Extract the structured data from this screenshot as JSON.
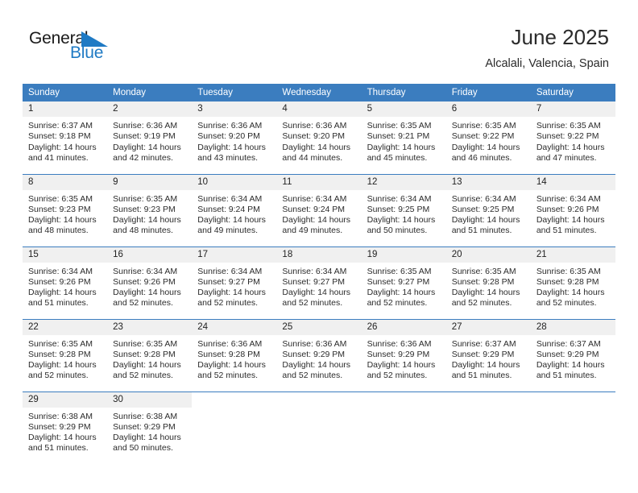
{
  "brand": {
    "word_general": "General",
    "word_blue": "Blue",
    "flag_icon": "triangle-flag-icon"
  },
  "header": {
    "title": "June 2025",
    "location": "Alcalali, Valencia, Spain"
  },
  "colors": {
    "header_blue": "#3b7dbf",
    "brand_blue": "#1f7ac4",
    "daynum_bg": "#f0f0f0",
    "text": "#2b2b2b"
  },
  "calendar": {
    "weekday_headers": [
      "Sunday",
      "Monday",
      "Tuesday",
      "Wednesday",
      "Thursday",
      "Friday",
      "Saturday"
    ],
    "weeks": [
      [
        {
          "day": "1",
          "sunrise": "Sunrise: 6:37 AM",
          "sunset": "Sunset: 9:18 PM",
          "daylight": "Daylight: 14 hours and 41 minutes."
        },
        {
          "day": "2",
          "sunrise": "Sunrise: 6:36 AM",
          "sunset": "Sunset: 9:19 PM",
          "daylight": "Daylight: 14 hours and 42 minutes."
        },
        {
          "day": "3",
          "sunrise": "Sunrise: 6:36 AM",
          "sunset": "Sunset: 9:20 PM",
          "daylight": "Daylight: 14 hours and 43 minutes."
        },
        {
          "day": "4",
          "sunrise": "Sunrise: 6:36 AM",
          "sunset": "Sunset: 9:20 PM",
          "daylight": "Daylight: 14 hours and 44 minutes."
        },
        {
          "day": "5",
          "sunrise": "Sunrise: 6:35 AM",
          "sunset": "Sunset: 9:21 PM",
          "daylight": "Daylight: 14 hours and 45 minutes."
        },
        {
          "day": "6",
          "sunrise": "Sunrise: 6:35 AM",
          "sunset": "Sunset: 9:22 PM",
          "daylight": "Daylight: 14 hours and 46 minutes."
        },
        {
          "day": "7",
          "sunrise": "Sunrise: 6:35 AM",
          "sunset": "Sunset: 9:22 PM",
          "daylight": "Daylight: 14 hours and 47 minutes."
        }
      ],
      [
        {
          "day": "8",
          "sunrise": "Sunrise: 6:35 AM",
          "sunset": "Sunset: 9:23 PM",
          "daylight": "Daylight: 14 hours and 48 minutes."
        },
        {
          "day": "9",
          "sunrise": "Sunrise: 6:35 AM",
          "sunset": "Sunset: 9:23 PM",
          "daylight": "Daylight: 14 hours and 48 minutes."
        },
        {
          "day": "10",
          "sunrise": "Sunrise: 6:34 AM",
          "sunset": "Sunset: 9:24 PM",
          "daylight": "Daylight: 14 hours and 49 minutes."
        },
        {
          "day": "11",
          "sunrise": "Sunrise: 6:34 AM",
          "sunset": "Sunset: 9:24 PM",
          "daylight": "Daylight: 14 hours and 49 minutes."
        },
        {
          "day": "12",
          "sunrise": "Sunrise: 6:34 AM",
          "sunset": "Sunset: 9:25 PM",
          "daylight": "Daylight: 14 hours and 50 minutes."
        },
        {
          "day": "13",
          "sunrise": "Sunrise: 6:34 AM",
          "sunset": "Sunset: 9:25 PM",
          "daylight": "Daylight: 14 hours and 51 minutes."
        },
        {
          "day": "14",
          "sunrise": "Sunrise: 6:34 AM",
          "sunset": "Sunset: 9:26 PM",
          "daylight": "Daylight: 14 hours and 51 minutes."
        }
      ],
      [
        {
          "day": "15",
          "sunrise": "Sunrise: 6:34 AM",
          "sunset": "Sunset: 9:26 PM",
          "daylight": "Daylight: 14 hours and 51 minutes."
        },
        {
          "day": "16",
          "sunrise": "Sunrise: 6:34 AM",
          "sunset": "Sunset: 9:26 PM",
          "daylight": "Daylight: 14 hours and 52 minutes."
        },
        {
          "day": "17",
          "sunrise": "Sunrise: 6:34 AM",
          "sunset": "Sunset: 9:27 PM",
          "daylight": "Daylight: 14 hours and 52 minutes."
        },
        {
          "day": "18",
          "sunrise": "Sunrise: 6:34 AM",
          "sunset": "Sunset: 9:27 PM",
          "daylight": "Daylight: 14 hours and 52 minutes."
        },
        {
          "day": "19",
          "sunrise": "Sunrise: 6:35 AM",
          "sunset": "Sunset: 9:27 PM",
          "daylight": "Daylight: 14 hours and 52 minutes."
        },
        {
          "day": "20",
          "sunrise": "Sunrise: 6:35 AM",
          "sunset": "Sunset: 9:28 PM",
          "daylight": "Daylight: 14 hours and 52 minutes."
        },
        {
          "day": "21",
          "sunrise": "Sunrise: 6:35 AM",
          "sunset": "Sunset: 9:28 PM",
          "daylight": "Daylight: 14 hours and 52 minutes."
        }
      ],
      [
        {
          "day": "22",
          "sunrise": "Sunrise: 6:35 AM",
          "sunset": "Sunset: 9:28 PM",
          "daylight": "Daylight: 14 hours and 52 minutes."
        },
        {
          "day": "23",
          "sunrise": "Sunrise: 6:35 AM",
          "sunset": "Sunset: 9:28 PM",
          "daylight": "Daylight: 14 hours and 52 minutes."
        },
        {
          "day": "24",
          "sunrise": "Sunrise: 6:36 AM",
          "sunset": "Sunset: 9:28 PM",
          "daylight": "Daylight: 14 hours and 52 minutes."
        },
        {
          "day": "25",
          "sunrise": "Sunrise: 6:36 AM",
          "sunset": "Sunset: 9:29 PM",
          "daylight": "Daylight: 14 hours and 52 minutes."
        },
        {
          "day": "26",
          "sunrise": "Sunrise: 6:36 AM",
          "sunset": "Sunset: 9:29 PM",
          "daylight": "Daylight: 14 hours and 52 minutes."
        },
        {
          "day": "27",
          "sunrise": "Sunrise: 6:37 AM",
          "sunset": "Sunset: 9:29 PM",
          "daylight": "Daylight: 14 hours and 51 minutes."
        },
        {
          "day": "28",
          "sunrise": "Sunrise: 6:37 AM",
          "sunset": "Sunset: 9:29 PM",
          "daylight": "Daylight: 14 hours and 51 minutes."
        }
      ],
      [
        {
          "day": "29",
          "sunrise": "Sunrise: 6:38 AM",
          "sunset": "Sunset: 9:29 PM",
          "daylight": "Daylight: 14 hours and 51 minutes."
        },
        {
          "day": "30",
          "sunrise": "Sunrise: 6:38 AM",
          "sunset": "Sunset: 9:29 PM",
          "daylight": "Daylight: 14 hours and 50 minutes."
        },
        null,
        null,
        null,
        null,
        null
      ]
    ]
  }
}
